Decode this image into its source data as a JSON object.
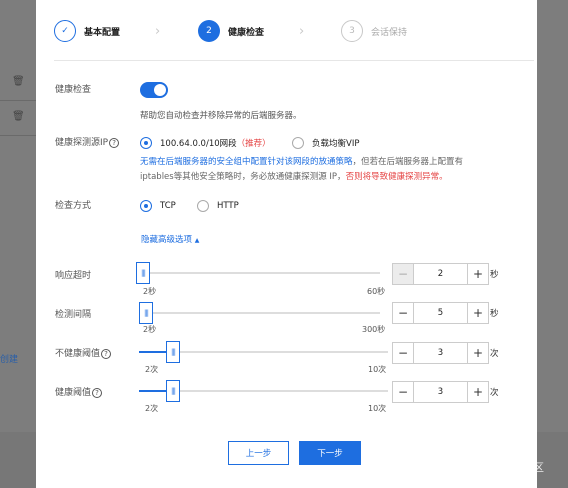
{
  "steps": [
    {
      "label": "基本配置",
      "number": "✓",
      "state": "done"
    },
    {
      "label": "健康检查",
      "number": "2",
      "state": "active"
    },
    {
      "label": "会话保持",
      "number": "3",
      "state": "todo"
    }
  ],
  "health_check": {
    "label": "健康检查",
    "enabled": true,
    "description": "帮助您自动检查并移除异常的后端服务器。"
  },
  "probe_source": {
    "label": "健康探测源IP",
    "option1": "100.64.0.0/10网段",
    "option1_tag": "（推荐）",
    "option2": "负载均衡VIP",
    "selected": "option1",
    "note_blue": "无需在后端服务器的安全组中配置针对该网段的放通策略",
    "note_grey1": "，但若在后端服务器上配置有",
    "note_grey2": "iptables等其他安全策略时，务必放通健康探测源 IP，",
    "note_red": "否则将导致健康探测异常。"
  },
  "check_method": {
    "label": "检查方式",
    "option_tcp": "TCP",
    "option_http": "HTTP",
    "selected": "TCP"
  },
  "advanced": {
    "toggle_label": "隐藏高级选项",
    "toggle_icon": "▲"
  },
  "response_timeout": {
    "label": "响应超时",
    "min_label": "2秒",
    "max_label": "60秒",
    "min": 2,
    "max": 60,
    "value": "2",
    "unit": "秒"
  },
  "check_interval": {
    "label": "检测间隔",
    "min_label": "2秒",
    "max_label": "300秒",
    "min": 2,
    "max": 300,
    "value": "5",
    "unit": "秒"
  },
  "unhealthy_threshold": {
    "label": "不健康阈值",
    "min_label": "2次",
    "max_label": "10次",
    "min": 2,
    "max": 10,
    "value": "3",
    "unit": "次"
  },
  "healthy_threshold": {
    "label": "健康阈值",
    "min_label": "2次",
    "max_label": "10次",
    "min": 2,
    "max": 10,
    "value": "3",
    "unit": "次"
  },
  "footer": {
    "prev_label": "上一步",
    "next_label": "下一步"
  },
  "background": {
    "link_text": "创建"
  },
  "watermark": "@稀土掘金技术社区",
  "colors": {
    "primary": "#1e6ee0",
    "danger": "#e54545"
  },
  "icons": {
    "help": "?",
    "minus": "−",
    "plus": "+",
    "chevron": "›",
    "delete": "trash-icon"
  }
}
